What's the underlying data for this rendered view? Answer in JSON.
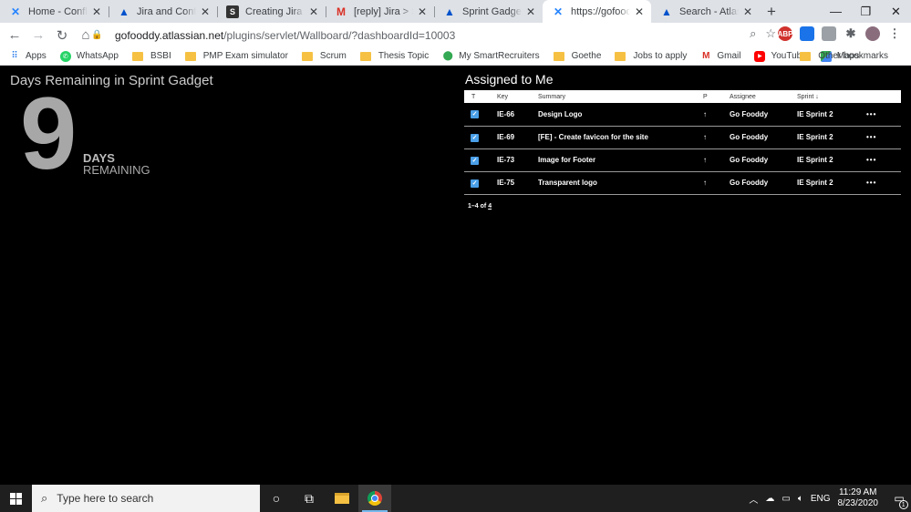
{
  "browser": {
    "tabs": [
      {
        "title": "Home - Confluence",
        "favicon": "confluence-icon",
        "color": "#2684ff"
      },
      {
        "title": "Jira and Confluence",
        "favicon": "atlassian-icon",
        "color": "#0052cc"
      },
      {
        "title": "Creating Jira issues",
        "favicon": "s-icon",
        "color": "#333333"
      },
      {
        "title": "[reply] Jira > Sprint",
        "favicon": "gmail-icon",
        "color": "#d93025"
      },
      {
        "title": "Sprint Gadget (remaining)",
        "favicon": "atlassian-icon",
        "color": "#0052cc"
      },
      {
        "title": "https://gofooddy.atlassian",
        "favicon": "confluence-icon",
        "color": "#2684ff"
      },
      {
        "title": "Search - Atlassian",
        "favicon": "atlassian-icon",
        "color": "#0052cc"
      }
    ],
    "active_tab": 5,
    "url_host": "gofooddy.atlassian.net",
    "url_path": "/plugins/servlet/Wallboard/?dashboardId=10003",
    "bookmarks": [
      {
        "label": "Apps",
        "icon": "apps-grid-icon"
      },
      {
        "label": "WhatsApp",
        "icon": "whatsapp-icon"
      },
      {
        "label": "BSBI",
        "icon": "folder-icon"
      },
      {
        "label": "PMP Exam simulator",
        "icon": "folder-icon"
      },
      {
        "label": "Scrum",
        "icon": "folder-icon"
      },
      {
        "label": "Thesis Topic",
        "icon": "folder-icon"
      },
      {
        "label": "My SmartRecruiters",
        "icon": "location-icon"
      },
      {
        "label": "Goethe",
        "icon": "folder-icon"
      },
      {
        "label": "Jobs to apply",
        "icon": "folder-icon"
      },
      {
        "label": "Gmail",
        "icon": "gmail-icon"
      },
      {
        "label": "YouTube",
        "icon": "youtube-icon"
      },
      {
        "label": "Maps",
        "icon": "maps-icon"
      }
    ],
    "other_bookmarks": "Other bookmarks"
  },
  "sprint_gadget": {
    "title": "Days Remaining in Sprint Gadget",
    "days": "9",
    "days_label": "DAYS",
    "remaining_label": "REMAINING"
  },
  "assigned": {
    "title": "Assigned to Me",
    "columns": {
      "type": "T",
      "key": "Key",
      "summary": "Summary",
      "priority": "P",
      "assignee": "Assignee",
      "sprint": "Sprint ↓"
    },
    "rows": [
      {
        "key": "IE-66",
        "summary": "Design Logo",
        "priority": "↑",
        "assignee": "Go Fooddy",
        "sprint": "IE Sprint 2"
      },
      {
        "key": "IE-69",
        "summary": "[FE] - Create favicon for the site",
        "priority": "↑",
        "assignee": "Go Fooddy",
        "sprint": "IE Sprint 2"
      },
      {
        "key": "IE-73",
        "summary": "Image for Footer",
        "priority": "↑",
        "assignee": "Go Fooddy",
        "sprint": "IE Sprint 2"
      },
      {
        "key": "IE-75",
        "summary": "Transparent logo",
        "priority": "↑",
        "assignee": "Go Fooddy",
        "sprint": "IE Sprint 2"
      }
    ],
    "pager_prefix": "1–4 of ",
    "pager_total": "4"
  },
  "taskbar": {
    "search_placeholder": "Type here to search",
    "language": "ENG",
    "time": "11:29 AM",
    "date": "8/23/2020",
    "notifications": "1"
  }
}
